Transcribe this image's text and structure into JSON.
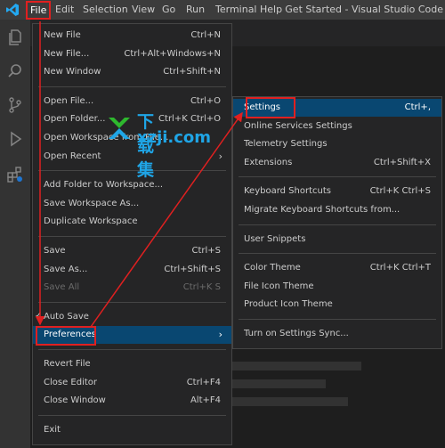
{
  "menubar": {
    "items": [
      "File",
      "Edit",
      "Selection",
      "View",
      "Go",
      "Run",
      "Terminal",
      "Help"
    ],
    "window_title": "Get Started - Visual Studio Code"
  },
  "file_menu": {
    "groups": [
      [
        {
          "label": "New File",
          "shortcut": "Ctrl+N"
        },
        {
          "label": "New File...",
          "shortcut": "Ctrl+Alt+Windows+N"
        },
        {
          "label": "New Window",
          "shortcut": "Ctrl+Shift+N"
        }
      ],
      [
        {
          "label": "Open File...",
          "shortcut": "Ctrl+O"
        },
        {
          "label": "Open Folder...",
          "shortcut": "Ctrl+K Ctrl+O"
        },
        {
          "label": "Open Workspace from File...",
          "shortcut": ""
        },
        {
          "label": "Open Recent",
          "shortcut": "",
          "submenu": true
        }
      ],
      [
        {
          "label": "Add Folder to Workspace...",
          "shortcut": ""
        },
        {
          "label": "Save Workspace As...",
          "shortcut": ""
        },
        {
          "label": "Duplicate Workspace",
          "shortcut": ""
        }
      ],
      [
        {
          "label": "Save",
          "shortcut": "Ctrl+S"
        },
        {
          "label": "Save As...",
          "shortcut": "Ctrl+Shift+S"
        },
        {
          "label": "Save All",
          "shortcut": "Ctrl+K S",
          "disabled": true
        }
      ],
      [
        {
          "label": "Auto Save",
          "shortcut": "",
          "checked": true
        },
        {
          "label": "Preferences",
          "shortcut": "",
          "submenu": true,
          "highlighted": true
        }
      ],
      [
        {
          "label": "Revert File",
          "shortcut": ""
        },
        {
          "label": "Close Editor",
          "shortcut": "Ctrl+F4"
        },
        {
          "label": "Close Window",
          "shortcut": "Alt+F4"
        }
      ],
      [
        {
          "label": "Exit",
          "shortcut": ""
        }
      ]
    ]
  },
  "preferences_menu": {
    "groups": [
      [
        {
          "label": "Settings",
          "shortcut": "Ctrl+,",
          "highlighted": true
        },
        {
          "label": "Online Services Settings",
          "shortcut": ""
        },
        {
          "label": "Telemetry Settings",
          "shortcut": ""
        },
        {
          "label": "Extensions",
          "shortcut": "Ctrl+Shift+X"
        }
      ],
      [
        {
          "label": "Keyboard Shortcuts",
          "shortcut": "Ctrl+K Ctrl+S"
        },
        {
          "label": "Migrate Keyboard Shortcuts from...",
          "shortcut": ""
        }
      ],
      [
        {
          "label": "User Snippets",
          "shortcut": ""
        }
      ],
      [
        {
          "label": "Color Theme",
          "shortcut": "Ctrl+K Ctrl+T"
        },
        {
          "label": "File Icon Theme",
          "shortcut": ""
        },
        {
          "label": "Product Icon Theme",
          "shortcut": ""
        }
      ],
      [
        {
          "label": "Turn on Settings Sync...",
          "shortcut": ""
        }
      ]
    ]
  },
  "watermark": {
    "line1": "下载集",
    "line2": "xzji.com"
  },
  "colors": {
    "accent": "#094771",
    "annotation": "#e02020",
    "menu_bg": "#252526"
  }
}
